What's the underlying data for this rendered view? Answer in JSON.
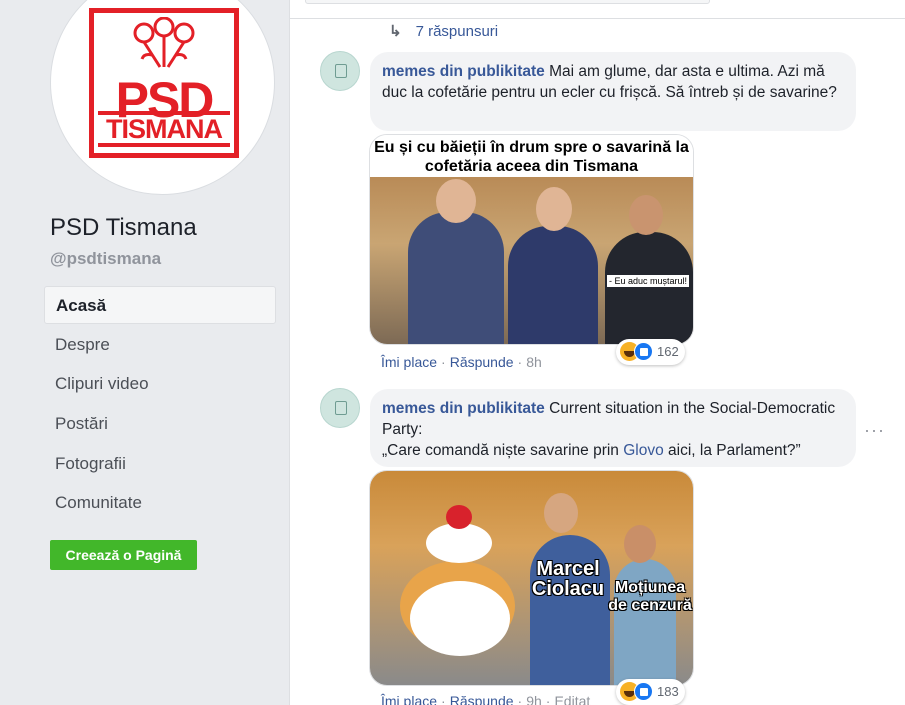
{
  "page": {
    "logo": {
      "line1": "PSD",
      "line2": "TISMANA",
      "color": "#e32027"
    },
    "name": "PSD Tismana",
    "handle": "@psdtismana",
    "nav": [
      {
        "label": "Acasă",
        "active": true
      },
      {
        "label": "Despre"
      },
      {
        "label": "Clipuri video"
      },
      {
        "label": "Postări"
      },
      {
        "label": "Fotografii"
      },
      {
        "label": "Comunitate"
      }
    ],
    "create_button": "Creează o Pagină"
  },
  "thread": {
    "replies_link": "7 răspunsuri",
    "comments": [
      {
        "author": "memes din publikitate",
        "text": "Mai am glume, dar asta e ultima. Azi mă duc la cofetărie pentru un ecler cu frișcă. Să întreb și de savarine?",
        "meme": {
          "title": "Eu și cu băieții în drum spre o savarină la cofetăria aceea din Tismana",
          "caption": "- Eu aduc muștarul!"
        },
        "actions": {
          "like": "Îmi place",
          "reply": "Răspunde",
          "time": "8h"
        },
        "reactions": {
          "count": "162",
          "icons": [
            "haha-icon",
            "like-icon"
          ]
        }
      },
      {
        "author": "memes din publikitate",
        "text_a": "Current situation in the Social-Democratic Party:",
        "text_b": "„Care comandă niște savarine prin",
        "link": "Glovo",
        "text_c": "aici, la Parlament?”",
        "meme": {
          "label1": "Marcel Ciolacu",
          "label2": "Moțiunea de cenzură"
        },
        "actions": {
          "like": "Îmi place",
          "reply": "Răspunde",
          "time": "9h",
          "edited": "Editat"
        },
        "reactions": {
          "count": "183",
          "icons": [
            "haha-icon",
            "like-icon"
          ]
        },
        "more": "···"
      }
    ]
  },
  "colors": {
    "link": "#385898",
    "create_green": "#42b72a",
    "bubble": "#f2f3f5"
  }
}
